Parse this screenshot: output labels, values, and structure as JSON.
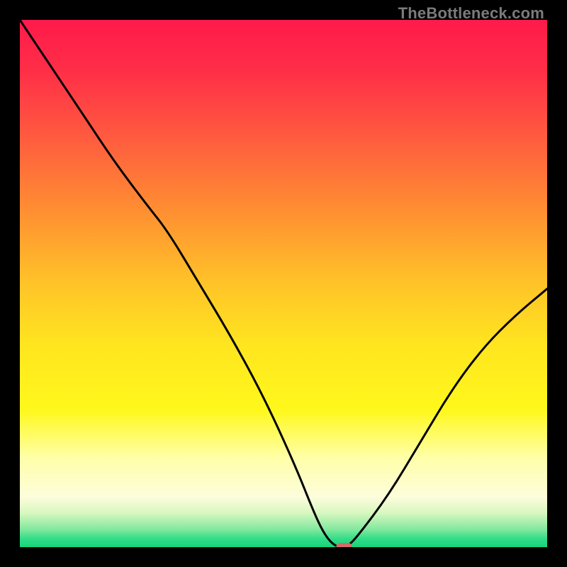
{
  "watermark": "TheBottleneck.com",
  "accent_marker_color": "#d46a6a",
  "curve_color": "#000000",
  "gradient_stops": [
    {
      "offset": 0.0,
      "color": "#ff1a4b"
    },
    {
      "offset": 0.1,
      "color": "#ff2f47"
    },
    {
      "offset": 0.22,
      "color": "#ff5a3f"
    },
    {
      "offset": 0.35,
      "color": "#ff8a33"
    },
    {
      "offset": 0.5,
      "color": "#ffc328"
    },
    {
      "offset": 0.62,
      "color": "#ffe61f"
    },
    {
      "offset": 0.74,
      "color": "#fff81c"
    },
    {
      "offset": 0.83,
      "color": "#ffffa8"
    },
    {
      "offset": 0.905,
      "color": "#fdfddc"
    },
    {
      "offset": 0.935,
      "color": "#d8f7c0"
    },
    {
      "offset": 0.965,
      "color": "#86e9a0"
    },
    {
      "offset": 0.985,
      "color": "#2fdc87"
    },
    {
      "offset": 1.0,
      "color": "#17d47c"
    }
  ],
  "chart_data": {
    "type": "line",
    "title": "",
    "xlabel": "",
    "ylabel": "",
    "xlim": [
      0,
      100
    ],
    "ylim": [
      0,
      100
    ],
    "grid": false,
    "x": [
      0,
      6,
      12,
      18,
      24,
      28,
      34,
      40,
      46,
      52,
      56,
      58,
      60,
      62,
      64,
      70,
      76,
      82,
      88,
      94,
      100
    ],
    "values": [
      100,
      91,
      82,
      73,
      65,
      60,
      50,
      40,
      29,
      16,
      6,
      2,
      0,
      0,
      2,
      10,
      20,
      30,
      38,
      44,
      49
    ],
    "marker": {
      "x_start": 60,
      "x_end": 63,
      "y": 0
    }
  }
}
